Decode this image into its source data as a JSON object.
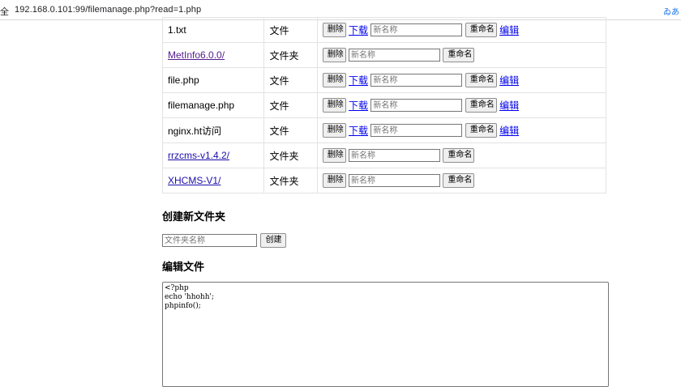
{
  "browser": {
    "left_fragment": "全",
    "url": "192.168.0.101:99/filemanage.php?read=1.php",
    "right_fragment": "ゐあ"
  },
  "files": [
    {
      "name": "1.txt",
      "type": "文件",
      "is_dir": false,
      "link": false
    },
    {
      "name": "MetInfo6.0.0/",
      "type": "文件夹",
      "is_dir": true,
      "link": true,
      "visited": true
    },
    {
      "name": "file.php",
      "type": "文件",
      "is_dir": false,
      "link": false
    },
    {
      "name": "filemanage.php",
      "type": "文件",
      "is_dir": false,
      "link": false
    },
    {
      "name": "nginx.ht访问",
      "type": "文件",
      "is_dir": false,
      "link": false
    },
    {
      "name": "rrzcms-v1.4.2/",
      "type": "文件夹",
      "is_dir": true,
      "link": true
    },
    {
      "name": "XHCMS-V1/",
      "type": "文件夹",
      "is_dir": true,
      "link": true
    }
  ],
  "actions": {
    "delete": "删除",
    "download": "下载",
    "new_name_placeholder": "新名称",
    "rename": "重命名",
    "edit": "编辑"
  },
  "create_folder": {
    "heading": "创建新文件夹",
    "placeholder": "文件夹名称",
    "button": "创建"
  },
  "edit_file": {
    "heading": "编辑文件",
    "content": "<?php\necho 'hhohh';\nphpinfo();"
  }
}
